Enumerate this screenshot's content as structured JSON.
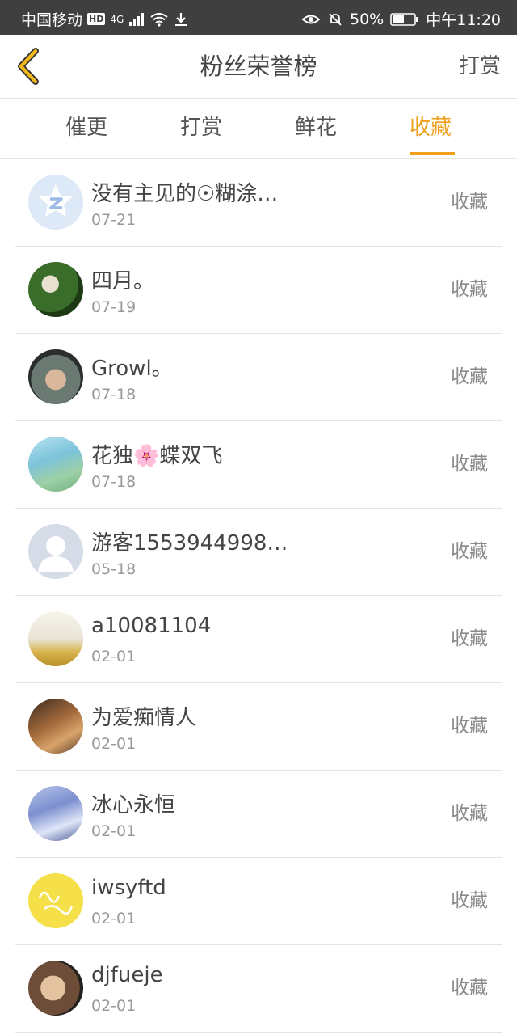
{
  "status_bar": {
    "carrier": "中国移动",
    "hd": "HD",
    "network": "4G",
    "battery": "50%",
    "time": "中午11:20"
  },
  "header": {
    "back_icon": "chevron-left-icon",
    "title": "粉丝荣誉榜",
    "action": "打赏"
  },
  "tabs": [
    {
      "label": "催更"
    },
    {
      "label": "打赏"
    },
    {
      "label": "鲜花"
    },
    {
      "label": "收藏",
      "active": true
    }
  ],
  "colors": {
    "accent": "#f0a01c",
    "status_bar": "#3f3f3f"
  },
  "list": [
    {
      "name": "没有主见的☉糊涂…",
      "date": "07-21",
      "tag": "收藏"
    },
    {
      "name": "四月。",
      "date": "07-19",
      "tag": "收藏"
    },
    {
      "name": "Growl。",
      "date": "07-18",
      "tag": "收藏"
    },
    {
      "name": "花独🌸蝶双飞",
      "date": "07-18",
      "tag": "收藏"
    },
    {
      "name": "游客1553944998…",
      "date": "05-18",
      "tag": "收藏"
    },
    {
      "name": "a10081104",
      "date": "02-01",
      "tag": "收藏"
    },
    {
      "name": "为爱痴情人",
      "date": "02-01",
      "tag": "收藏"
    },
    {
      "name": "冰心永恒",
      "date": "02-01",
      "tag": "收藏"
    },
    {
      "name": "iwsyftd",
      "date": "02-01",
      "tag": "收藏"
    },
    {
      "name": "djfueje",
      "date": "02-01",
      "tag": "收藏"
    }
  ]
}
